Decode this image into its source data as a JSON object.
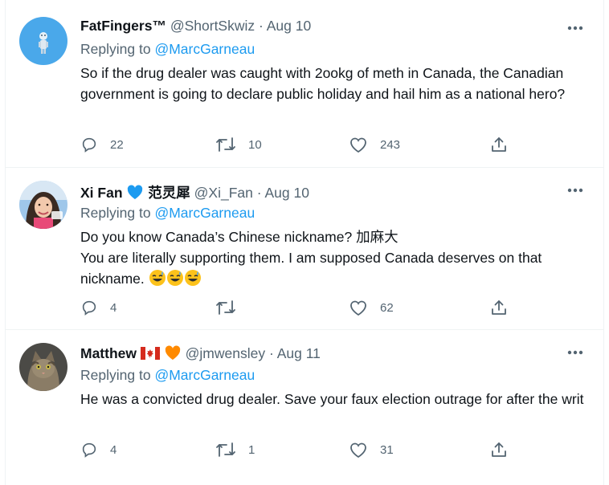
{
  "tweets": [
    {
      "display_name": "FatFingers™",
      "handle": "@ShortSkwiz",
      "dot": "·",
      "date": "Aug 10",
      "replying_prefix": "Replying to",
      "replying_to": "@MarcGarneau",
      "text_lines": [
        "So if the drug dealer was caught with 2ookg of meth in Canada, the Canadian government is going to declare public holiday and hail him as a national hero?"
      ],
      "replies": "22",
      "retweets": "10",
      "likes": "243",
      "avatar_bg": "#4aa8ea"
    },
    {
      "display_name": "Xi Fan",
      "name_suffix": "范灵犀",
      "handle": "@Xi_Fan",
      "dot": "·",
      "date": "Aug 10",
      "replying_prefix": "Replying to",
      "replying_to": "@MarcGarneau",
      "text_lines": [
        "Do you know Canada’s Chinese nickname? 加麻大",
        "You are literally supporting them. I am supposed Canada deserves on that nickname."
      ],
      "replies": "4",
      "retweets": "",
      "likes": "62",
      "heart_color": "#1d9bf0",
      "emoji": "sweat-smile-emoji x3"
    },
    {
      "display_name": "Matthew",
      "handle": "@jmwensley",
      "dot": "·",
      "date": "Aug 11",
      "replying_prefix": "Replying to",
      "replying_to": "@MarcGarneau",
      "text_lines": [
        "He was a convicted drug dealer. Save your faux election outrage for after the writ"
      ],
      "replies": "4",
      "retweets": "1",
      "likes": "31",
      "heart_color": "#ff8a00"
    }
  ],
  "colors": {
    "link": "#1d9bf0",
    "muted": "#536471",
    "text": "#0f1419",
    "border": "#eff3f4"
  }
}
